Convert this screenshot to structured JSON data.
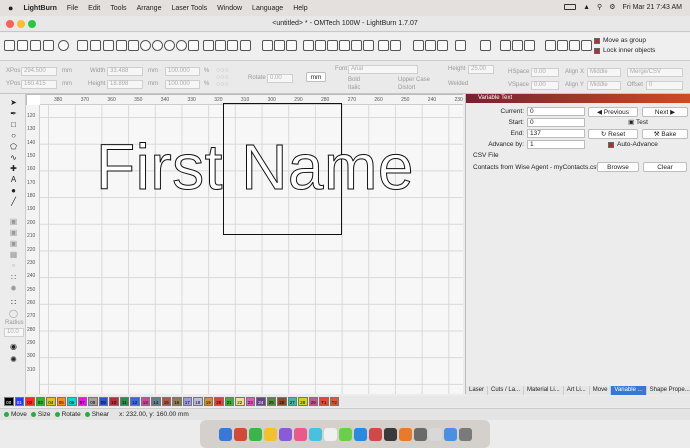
{
  "menubar": {
    "app_name": "LightBurn",
    "items": [
      "File",
      "Edit",
      "Tools",
      "Arrange",
      "Laser Tools",
      "Window",
      "Language",
      "Help"
    ],
    "clock": "Fri Mar 21  7:43 AM"
  },
  "window": {
    "title": "<untitled> * - OMTech 100W - LightBurn 1.7.07"
  },
  "toolbar": {
    "move_as_group": "Move as group",
    "lock_inner": "Lock inner objects"
  },
  "props": {
    "xpos_label": "XPos",
    "xpos_value": "294.500",
    "ypos_label": "YPos",
    "ypos_value": "160.415",
    "unit": "mm",
    "width_label": "Width",
    "width_value": "33.488",
    "height_label": "Height",
    "height_value": "18.898",
    "pct1": "100.000",
    "pct2": "100.000",
    "pct_sign": "%",
    "rotate_label": "Rotate",
    "rotate_value": "0.00",
    "mm_button": "mm",
    "font_label": "Font",
    "font_value": "Arial",
    "height2_label": "Height",
    "height2_value": "25.00",
    "hspace_label": "HSpace",
    "hspace_value": "0.00",
    "vspace_label": "VSpace",
    "vspace_value": "0.00",
    "alignx_label": "Align X",
    "alignx_value": "Middle",
    "aligny_label": "Align Y",
    "aligny_value": "Middle",
    "merge_value": "Merge/CSV",
    "offset_label": "Offset",
    "offset_value": "0",
    "bold": "Bold",
    "italic": "Italic",
    "upper": "Upper Case",
    "distort": "Distort",
    "welded": "Welded"
  },
  "ruler": {
    "h": [
      "380",
      "370",
      "360",
      "350",
      "340",
      "330",
      "320",
      "310",
      "300",
      "290",
      "280",
      "270",
      "260",
      "250",
      "240",
      "230"
    ],
    "v": [
      "120",
      "130",
      "140",
      "150",
      "160",
      "170",
      "180",
      "190",
      "200",
      "210",
      "220",
      "230",
      "240",
      "250",
      "260",
      "270",
      "280",
      "290",
      "300",
      "310"
    ]
  },
  "canvas": {
    "text": "First Name"
  },
  "panel": {
    "title": "Variable Text",
    "current_label": "Current:",
    "current_value": "0",
    "start_label": "Start:",
    "start_value": "0",
    "end_label": "End:",
    "end_value": "137",
    "advance_label": "Advance by:",
    "advance_value": "1",
    "previous": "Previous",
    "next": "Next",
    "test": "Test",
    "reset": "Reset",
    "bake": "Bake",
    "auto_advance": "Auto-Advance",
    "csv_heading": "CSV File",
    "csv_name": "Contacts from Wise Agent - myContacts.csv",
    "browse": "Browse",
    "clear": "Clear",
    "tabs": [
      "Laser",
      "Cuts / La...",
      "Material Li...",
      "Art Li...",
      "Move",
      "Variable ...",
      "Shape Prope..."
    ]
  },
  "left": {
    "radius_label": "Radius",
    "radius_value": "10.0"
  },
  "palette": [
    {
      "label": "00",
      "color": "#000000"
    },
    {
      "label": "01",
      "color": "#1f3dff"
    },
    {
      "label": "02",
      "color": "#ff2a1f"
    },
    {
      "label": "03",
      "color": "#2fb52f"
    },
    {
      "label": "04",
      "color": "#d6c622"
    },
    {
      "label": "05",
      "color": "#ff8c1a"
    },
    {
      "label": "06",
      "color": "#1ad1d1"
    },
    {
      "label": "07",
      "color": "#e01ae0"
    },
    {
      "label": "08",
      "color": "#a0a0a0"
    },
    {
      "label": "09",
      "color": "#2c55c8"
    },
    {
      "label": "10",
      "color": "#b52f3a"
    },
    {
      "label": "11",
      "color": "#2d8c4a"
    },
    {
      "label": "12",
      "color": "#3b6ad6"
    },
    {
      "label": "13",
      "color": "#c84da0"
    },
    {
      "label": "14",
      "color": "#6b7d8c"
    },
    {
      "label": "15",
      "color": "#a85a45"
    },
    {
      "label": "16",
      "color": "#8c7c5a"
    },
    {
      "label": "17",
      "color": "#9b9bd9"
    },
    {
      "label": "18",
      "color": "#b7c0d6"
    },
    {
      "label": "19",
      "color": "#d18f3a"
    },
    {
      "label": "20",
      "color": "#e04040"
    },
    {
      "label": "21",
      "color": "#3fae3f"
    },
    {
      "label": "22",
      "color": "#e6e0a0"
    },
    {
      "label": "23",
      "color": "#d95fb5"
    },
    {
      "label": "24",
      "color": "#6a3f8c"
    },
    {
      "label": "25",
      "color": "#4f8c45"
    },
    {
      "label": "26",
      "color": "#8c4a2a"
    },
    {
      "label": "27",
      "color": "#45b5a0"
    },
    {
      "label": "28",
      "color": "#c8d820"
    },
    {
      "label": "29",
      "color": "#c05a8a"
    },
    {
      "label": "T1",
      "color": "#e04a3a"
    },
    {
      "label": "T2",
      "color": "#d85a3a"
    }
  ],
  "status": {
    "move": "Move",
    "size": "Size",
    "rotate": "Rotate",
    "shear": "Shear",
    "coords": "x: 232.00, y: 160.00 mm"
  },
  "dock": {
    "colors": [
      "#3a78d8",
      "#d04a3a",
      "#3ab54a",
      "#f2c12e",
      "#8a5ad8",
      "#e85a8a",
      "#4ac0e0",
      "#f0f0f0",
      "#6ad04a",
      "#2a8ae0",
      "#d04848",
      "#3a3a3a",
      "#e87a2a",
      "#6a6a6a",
      "#d8d8d8",
      "#4a90e2",
      "#7a7a7a"
    ]
  }
}
